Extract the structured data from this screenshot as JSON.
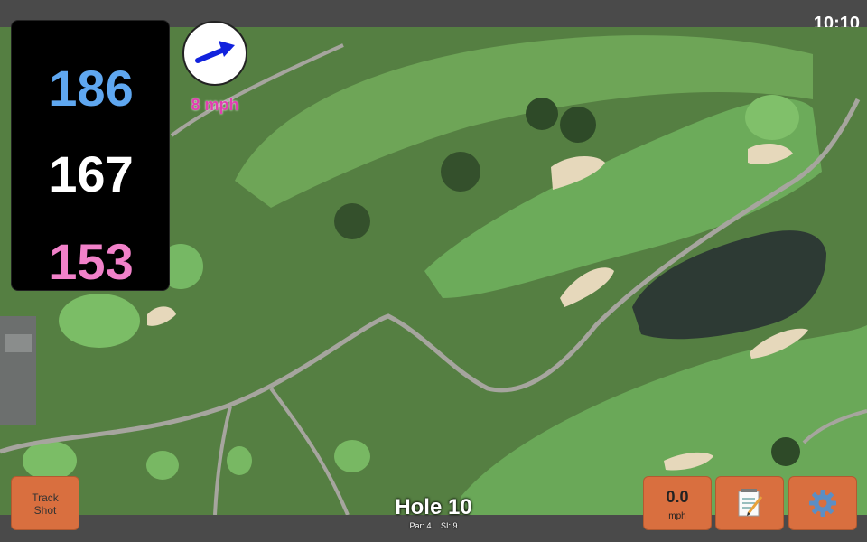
{
  "status": {
    "time": "10:10"
  },
  "yardages": {
    "back": "186",
    "middle": "167",
    "front": "153"
  },
  "wind": {
    "speed_label": "8 mph",
    "arrow_icon": "arrow-right-icon"
  },
  "hole": {
    "title": "Hole 10",
    "par_label": "Par: 4",
    "si_label": "SI: 9"
  },
  "buttons": {
    "track_shot_line1": "Track",
    "track_shot_line2": "Shot",
    "wind_value": "0.0",
    "wind_unit": "mph",
    "notes_icon": "notepad-icon",
    "settings_icon": "gear-icon"
  },
  "colors": {
    "accent_button": "#d96f3f",
    "back_yardage": "#5fa7f0",
    "middle_yardage": "#ffffff",
    "front_yardage": "#f181c9",
    "wind_text": "#e23fb1"
  }
}
